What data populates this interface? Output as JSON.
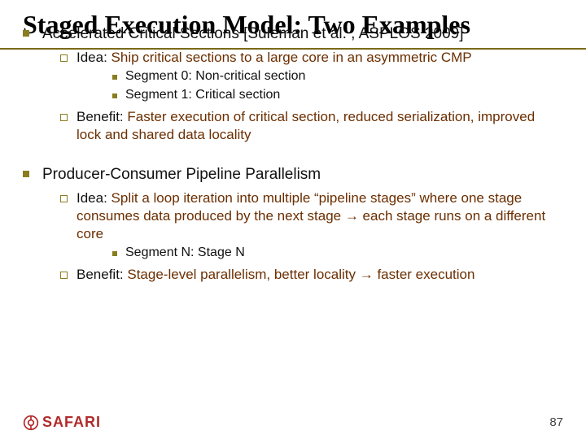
{
  "title": "Staged Execution Model: Two Examples",
  "page_number": "87",
  "logo_text": "SAFARI",
  "sections": [
    {
      "heading_prefix": "Accelerated Critical Sections ",
      "heading_suffix": "[Suleman et al. , ASPLOS 2009]",
      "idea_label": "Idea: ",
      "idea_body": "Ship critical sections to a large core in an asymmetric CMP",
      "segments": [
        "Segment 0: Non-critical section",
        "Segment 1: Critical section"
      ],
      "benefit_label": "Benefit: ",
      "benefit_body": "Faster execution of critical section, reduced serialization, improved lock and shared data locality"
    },
    {
      "heading_prefix": "Producer-Consumer Pipeline Parallelism",
      "heading_suffix": "",
      "idea_label": "Idea: ",
      "idea_body": "Split a loop iteration into multiple “pipeline stages” where one stage consumes data produced by the next stage → each stage runs on a different core",
      "segments": [
        "Segment N: Stage N"
      ],
      "benefit_label": "Benefit: ",
      "benefit_body": "Stage-level parallelism, better locality → faster execution"
    }
  ]
}
